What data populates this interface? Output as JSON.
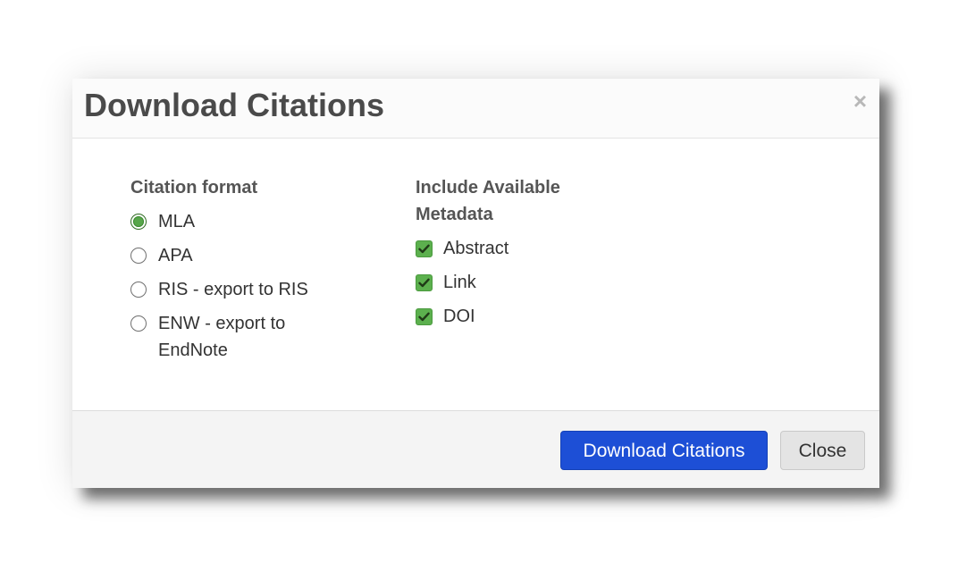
{
  "dialog": {
    "title": "Download Citations",
    "close_icon": "×"
  },
  "format_section": {
    "label": "Citation format",
    "options": [
      {
        "label": "MLA",
        "checked": true
      },
      {
        "label": "APA",
        "checked": false
      },
      {
        "label": "RIS - export to RIS",
        "checked": false
      },
      {
        "label": "ENW - export to EndNote",
        "checked": false
      }
    ]
  },
  "metadata_section": {
    "label": "Include Available Metadata",
    "options": [
      {
        "label": "Abstract",
        "checked": true
      },
      {
        "label": "Link",
        "checked": true
      },
      {
        "label": "DOI",
        "checked": true
      }
    ]
  },
  "footer": {
    "download_label": "Download Citations",
    "close_label": "Close"
  },
  "colors": {
    "primary_button": "#1d4fd6",
    "checkbox_checked": "#5cb04e",
    "radio_checked": "#57a64a",
    "title_text": "#4a4a4a"
  }
}
